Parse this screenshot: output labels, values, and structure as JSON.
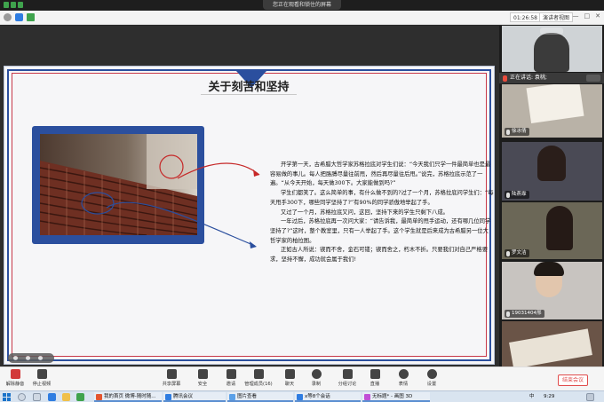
{
  "notice": {
    "text": "您正在观看和锁住的屏幕",
    "signal_colors": [
      "#3fa34d",
      "#3fa34d",
      "#3fa34d"
    ]
  },
  "meeting_toolbar": {
    "info_icon": "info-icon",
    "shield_icon": "shield-icon",
    "signal_icon": "signal-icon",
    "timer": "01:26:58",
    "view_label": "演讲者视图",
    "min": "—",
    "max": "□",
    "close": "✕"
  },
  "slide": {
    "title": "关于刻苦和坚持",
    "paragraphs": [
      "开学第一天，古希腊大哲学家苏格拉底对学生们说：“今天我们只学一件最简单也是最容易做的事儿。每人把胳膊尽量往前甩，然后再尽量往后甩。”说完，苏格拉底示范了一遍。“从今天开始，每天做300下。大家能做到吗?”",
      "学生们都笑了。这么简单的事，有什么做不到的?过了一个月，苏格拉底问学生们：“每天甩手300下，哪些同学坚持了?”有90%的同学骄傲地举起了手。",
      "又过了一个月，苏格拉底又问，这回，坚持下来的学生只剩下八成。",
      "一年过后，苏格拉底再一次问大家：“请告诉我，最简单的甩手运动，还有哪几位同学坚持了?”这时，整个教室里，只有一人举起了手。这个学生就是后来成为古希腊另一位大哲学家的柏拉图。",
      "正如古人所说：锲而不舍，金石可镂；锲而舍之，朽木不折。只要我们对自己严格要求，坚持不懈，成功就会属于我们!"
    ],
    "photo_alt": "lecture-hall-seats-photo"
  },
  "gallery": {
    "speaking_label": "正在讲话: 袁桃;",
    "tiles": [
      {
        "name": "",
        "bg": "#cfd3d6"
      },
      {
        "name": "徐冰倩",
        "bg": "#b9b2a7"
      },
      {
        "name": "陆燕霏",
        "bg": "#4a4a55"
      },
      {
        "name": "罗文洁",
        "bg": "#6b6757"
      },
      {
        "name": "19031404邢",
        "bg": "#c8c4c0"
      },
      {
        "name": "",
        "bg": "#6a5447"
      }
    ]
  },
  "controls": {
    "items": [
      {
        "label": "解除静音",
        "icon": "mic-muted-icon",
        "color": "#d23b3b"
      },
      {
        "label": "停止视频",
        "icon": "video-icon",
        "color": "#444444"
      },
      {
        "label": "共享屏幕",
        "icon": "share-screen-icon",
        "color": "#444444"
      },
      {
        "label": "安全",
        "icon": "shield-icon",
        "color": "#444444"
      },
      {
        "label": "邀请",
        "icon": "invite-icon",
        "color": "#444444"
      },
      {
        "label": "管理成员(16)",
        "icon": "members-icon",
        "color": "#444444"
      },
      {
        "label": "聊天",
        "icon": "chat-icon",
        "color": "#444444"
      },
      {
        "label": "录制",
        "icon": "record-icon",
        "color": "#444444"
      },
      {
        "label": "分组讨论",
        "icon": "breakout-icon",
        "color": "#444444"
      },
      {
        "label": "直播",
        "icon": "live-icon",
        "color": "#444444"
      },
      {
        "label": "表情",
        "icon": "emoji-icon",
        "color": "#444444"
      },
      {
        "label": "设置",
        "icon": "settings-icon",
        "color": "#444444"
      }
    ],
    "end_label": "结束会议"
  },
  "taskbar": {
    "tasks": [
      {
        "label": "我的首页 微博-随时随...",
        "color": "#e3552f"
      },
      {
        "label": "腾讯会议",
        "color": "#2f7de1"
      },
      {
        "label": "图片查看",
        "color": "#5aa0e8"
      },
      {
        "label": "x等8个会话",
        "color": "#2f7de1"
      },
      {
        "label": "无标题* - 画图 3D",
        "color": "#c14fd6"
      }
    ],
    "lang": "中",
    "time": "9:29"
  },
  "colors": {
    "frame_blue": "#2b4f9e",
    "frame_red": "#c8394a",
    "accent_red": "#e04b4b"
  }
}
